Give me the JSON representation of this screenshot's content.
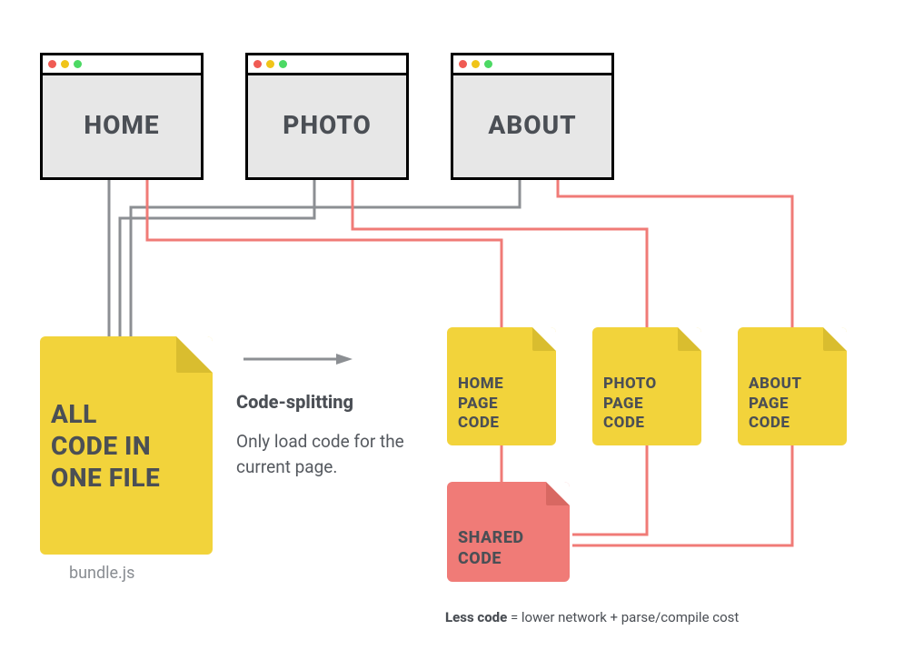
{
  "browsers": {
    "home": {
      "title": "HOME"
    },
    "photo": {
      "title": "PHOTO"
    },
    "about": {
      "title": "ABOUT"
    }
  },
  "bundle": {
    "label": "ALL\nCODE IN\nONE FILE",
    "filename": "bundle.js"
  },
  "explain": {
    "heading": "Code-splitting",
    "body": "Only load code for the current page."
  },
  "chunks": {
    "home": {
      "label": "HOME\nPAGE\nCODE"
    },
    "photo": {
      "label": "PHOTO\nPAGE\nCODE"
    },
    "about": {
      "label": "ABOUT\nPAGE\nCODE"
    },
    "shared": {
      "label": "SHARED\nCODE"
    }
  },
  "footer": {
    "bold": "Less code",
    "rest": " = lower network + parse/compile cost"
  },
  "colors": {
    "yellow": "#f2d33b",
    "red": "#f07b77",
    "gray_line": "#8c8f93",
    "red_line": "#f07b77",
    "text": "#4b4f55"
  }
}
